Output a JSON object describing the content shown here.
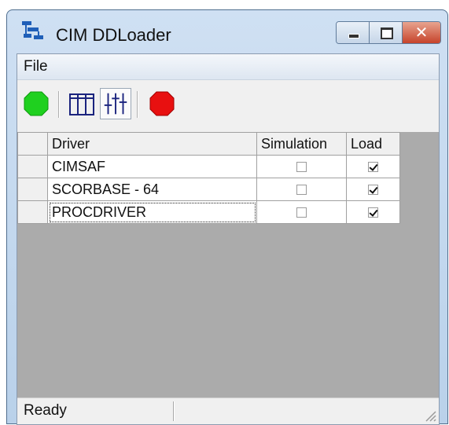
{
  "window": {
    "title": "CIM DDLoader"
  },
  "menu": {
    "file_label": "File"
  },
  "toolbar": {
    "buttons": [
      {
        "icon": "green-go-icon",
        "color": "#22cc22"
      },
      {
        "icon": "table-columns-icon"
      },
      {
        "icon": "sliders-icon",
        "pressed": true
      },
      {
        "icon": "red-stop-icon",
        "color": "#e01010"
      }
    ]
  },
  "grid": {
    "headers": {
      "driver": "Driver",
      "simulation": "Simulation",
      "load": "Load"
    },
    "rows": [
      {
        "driver": "CIMSAF",
        "simulation": false,
        "load": true
      },
      {
        "driver": "SCORBASE - 64",
        "simulation": false,
        "load": true
      },
      {
        "driver": "PROCDRIVER",
        "simulation": false,
        "load": true
      }
    ]
  },
  "status": {
    "text": "Ready"
  }
}
